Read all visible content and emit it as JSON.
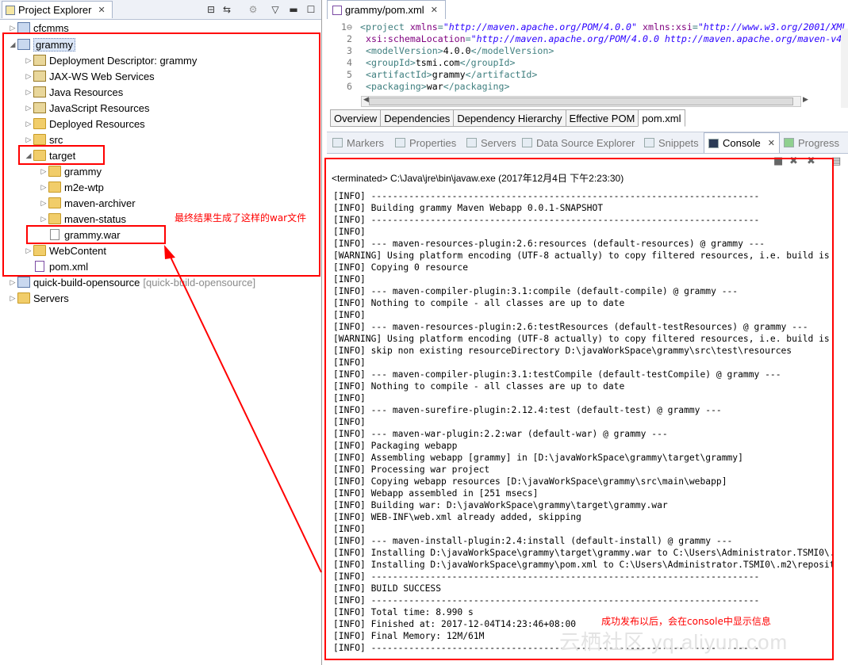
{
  "explorer": {
    "tab_title": "Project Explorer",
    "items": [
      {
        "label": "cfcmms",
        "suffix": ""
      },
      {
        "label": "grammy",
        "suffix": ""
      },
      {
        "label": "Deployment Descriptor: grammy",
        "suffix": ""
      },
      {
        "label": "JAX-WS Web Services",
        "suffix": ""
      },
      {
        "label": "Java Resources",
        "suffix": ""
      },
      {
        "label": "JavaScript Resources",
        "suffix": ""
      },
      {
        "label": "Deployed Resources",
        "suffix": ""
      },
      {
        "label": "src",
        "suffix": ""
      },
      {
        "label": "target",
        "suffix": ""
      },
      {
        "label": "grammy",
        "suffix": ""
      },
      {
        "label": "m2e-wtp",
        "suffix": ""
      },
      {
        "label": "maven-archiver",
        "suffix": ""
      },
      {
        "label": "maven-status",
        "suffix": ""
      },
      {
        "label": "grammy.war",
        "suffix": ""
      },
      {
        "label": "WebContent",
        "suffix": ""
      },
      {
        "label": "pom.xml",
        "suffix": ""
      },
      {
        "label": "quick-build-opensource",
        "suffix": "[quick-build-opensource]"
      },
      {
        "label": "Servers",
        "suffix": ""
      }
    ]
  },
  "annotations": {
    "war_note": "最终结果生成了这样的war文件",
    "console_note": "成功发布以后，会在console中显示信息"
  },
  "editor": {
    "tab_title": "grammy/pom.xml",
    "lines": [
      {
        "num": "1⊖",
        "parts": [
          [
            "tag",
            "<project "
          ],
          [
            "attr",
            "xmlns"
          ],
          [
            "tag",
            "="
          ],
          [
            "str",
            "\"http://maven.apache.org/POM/4.0.0\""
          ],
          [
            "tag",
            " "
          ],
          [
            "attr",
            "xmlns:xsi"
          ],
          [
            "tag",
            "="
          ],
          [
            "str",
            "\"http://www.w3.org/2001/XML"
          ]
        ]
      },
      {
        "num": "2",
        "parts": [
          [
            "tag",
            "  "
          ],
          [
            "attr",
            "xsi:schemaLocation"
          ],
          [
            "tag",
            "="
          ],
          [
            "str",
            "\"http://maven.apache.org/POM/4.0.0 http://maven.apache.org/maven-v4"
          ]
        ]
      },
      {
        "num": "3",
        "parts": [
          [
            "tag",
            "  <modelVersion>"
          ],
          [
            "txt",
            "4.0.0"
          ],
          [
            "tag",
            "</modelVersion>"
          ]
        ]
      },
      {
        "num": "4",
        "parts": [
          [
            "tag",
            "  <groupId>"
          ],
          [
            "txt",
            "tsmi.com"
          ],
          [
            "tag",
            "</groupId>"
          ]
        ]
      },
      {
        "num": "5",
        "parts": [
          [
            "tag",
            "  <artifactId>"
          ],
          [
            "txt",
            "grammy"
          ],
          [
            "tag",
            "</artifactId>"
          ]
        ]
      },
      {
        "num": "6",
        "parts": [
          [
            "tag",
            "  <packaging>"
          ],
          [
            "txt",
            "war"
          ],
          [
            "tag",
            "</packaging>"
          ]
        ]
      }
    ],
    "pom_tabs": [
      "Overview",
      "Dependencies",
      "Dependency Hierarchy",
      "Effective POM",
      "pom.xml"
    ]
  },
  "views": {
    "tabs": [
      "Markers",
      "Properties",
      "Servers",
      "Data Source Explorer",
      "Snippets",
      "Console",
      "Progress"
    ],
    "active": "Console"
  },
  "console": {
    "header": "<terminated> C:\\Java\\jre\\bin\\javaw.exe (2017年12月4日 下午2:23:30)",
    "lines": [
      "[INFO] ------------------------------------------------------------------------",
      "[INFO] Building grammy Maven Webapp 0.0.1-SNAPSHOT",
      "[INFO] ------------------------------------------------------------------------",
      "[INFO]",
      "[INFO] --- maven-resources-plugin:2.6:resources (default-resources) @ grammy ---",
      "[WARNING] Using platform encoding (UTF-8 actually) to copy filtered resources, i.e. build is",
      "[INFO] Copying 0 resource",
      "[INFO]",
      "[INFO] --- maven-compiler-plugin:3.1:compile (default-compile) @ grammy ---",
      "[INFO] Nothing to compile - all classes are up to date",
      "[INFO]",
      "[INFO] --- maven-resources-plugin:2.6:testResources (default-testResources) @ grammy ---",
      "[WARNING] Using platform encoding (UTF-8 actually) to copy filtered resources, i.e. build is",
      "[INFO] skip non existing resourceDirectory D:\\javaWorkSpace\\grammy\\src\\test\\resources",
      "[INFO]",
      "[INFO] --- maven-compiler-plugin:3.1:testCompile (default-testCompile) @ grammy ---",
      "[INFO] Nothing to compile - all classes are up to date",
      "[INFO]",
      "[INFO] --- maven-surefire-plugin:2.12.4:test (default-test) @ grammy ---",
      "[INFO]",
      "[INFO] --- maven-war-plugin:2.2:war (default-war) @ grammy ---",
      "[INFO] Packaging webapp",
      "[INFO] Assembling webapp [grammy] in [D:\\javaWorkSpace\\grammy\\target\\grammy]",
      "[INFO] Processing war project",
      "[INFO] Copying webapp resources [D:\\javaWorkSpace\\grammy\\src\\main\\webapp]",
      "[INFO] Webapp assembled in [251 msecs]",
      "[INFO] Building war: D:\\javaWorkSpace\\grammy\\target\\grammy.war",
      "[INFO] WEB-INF\\web.xml already added, skipping",
      "[INFO]",
      "[INFO] --- maven-install-plugin:2.4:install (default-install) @ grammy ---",
      "[INFO] Installing D:\\javaWorkSpace\\grammy\\target\\grammy.war to C:\\Users\\Administrator.TSMI0\\.",
      "[INFO] Installing D:\\javaWorkSpace\\grammy\\pom.xml to C:\\Users\\Administrator.TSMI0\\.m2\\reposit",
      "[INFO] ------------------------------------------------------------------------",
      "[INFO] BUILD SUCCESS",
      "[INFO] ------------------------------------------------------------------------",
      "[INFO] Total time: 8.990 s",
      "[INFO] Finished at: 2017-12-04T14:23:46+08:00",
      "[INFO] Final Memory: 12M/61M",
      "[INFO] ------------------------------------------------------------------------"
    ]
  },
  "watermark": "云栖社区 yq.aliyun.com"
}
